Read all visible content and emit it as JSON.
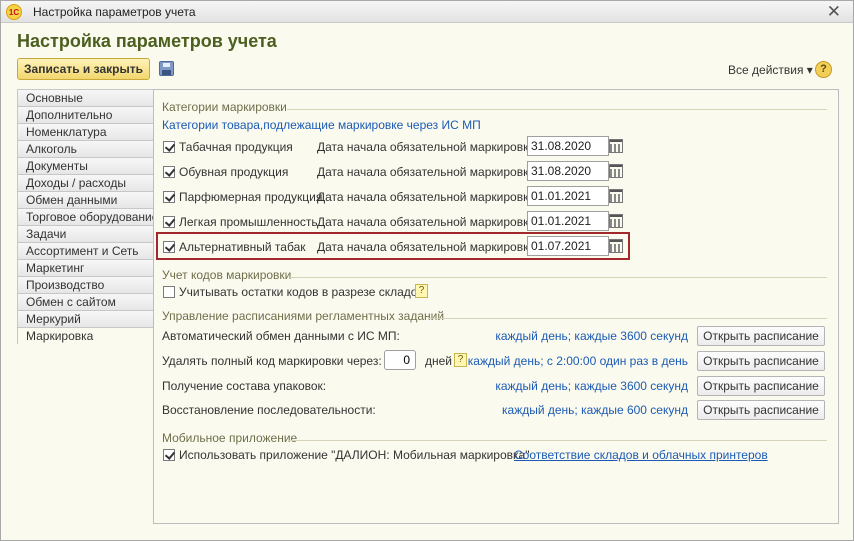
{
  "window": {
    "title": "Настройка параметров учета",
    "app_icon": "1С"
  },
  "page": {
    "title": "Настройка параметров учета"
  },
  "toolbar": {
    "save_close_label": "Записать и закрыть",
    "all_actions_label": "Все действия ▾",
    "help_label": "?"
  },
  "tabs": [
    {
      "label": "Основные"
    },
    {
      "label": "Дополнительно"
    },
    {
      "label": "Номенклатура"
    },
    {
      "label": "Алкоголь"
    },
    {
      "label": "Документы"
    },
    {
      "label": "Доходы / расходы"
    },
    {
      "label": "Обмен данными"
    },
    {
      "label": "Торговое оборудование"
    },
    {
      "label": "Задачи"
    },
    {
      "label": "Ассортимент и Сеть"
    },
    {
      "label": "Маркетинг"
    },
    {
      "label": "Производство"
    },
    {
      "label": "Обмен с сайтом"
    },
    {
      "label": "Меркурий"
    },
    {
      "label": "Маркировка"
    }
  ],
  "active_tab": "Маркировка",
  "categories": {
    "title": "Категории маркировки",
    "subtitle": "Категории товара,подлежащие маркировке через ИС МП",
    "date_label": "Дата начала обязательной маркировки:",
    "rows": [
      {
        "label": "Табачная продукция",
        "checked": true,
        "date": "31.08.2020"
      },
      {
        "label": "Обувная продукция",
        "checked": true,
        "date": "31.08.2020"
      },
      {
        "label": "Парфюмерная продукция",
        "checked": true,
        "date": "01.01.2021"
      },
      {
        "label": "Легкая промышленность",
        "checked": true,
        "date": "01.01.2021"
      },
      {
        "label": "Альтернативный табак",
        "checked": true,
        "date": "01.07.2021"
      }
    ]
  },
  "codes": {
    "title": "Учет кодов маркировки",
    "option_label": "Учитывать остатки кодов в разрезе складов",
    "checked": false
  },
  "schedules": {
    "title": "Управление расписаниями регламентных заданий",
    "button_label": "Открыть расписание",
    "days_unit": "дней",
    "days_value": "0",
    "rows": [
      {
        "label": "Автоматический обмен данными с ИС МП:",
        "schedule": "каждый день; каждые 3600 секунд"
      },
      {
        "label": "Удалять полный код маркировки через:",
        "schedule": "каждый день; с 2:00:00 один раз в день"
      },
      {
        "label": "Получение состава упаковок:",
        "schedule": "каждый день; каждые 3600 секунд"
      },
      {
        "label": "Восстановление последовательности:",
        "schedule": "каждый день; каждые 600 секунд"
      }
    ]
  },
  "mobile": {
    "title": "Мобильное приложение",
    "option_label": "Использовать приложение \"ДАЛИОН: Мобильная маркировка\"",
    "checked": true,
    "link": "Соответствие складов и облачных принтеров"
  }
}
